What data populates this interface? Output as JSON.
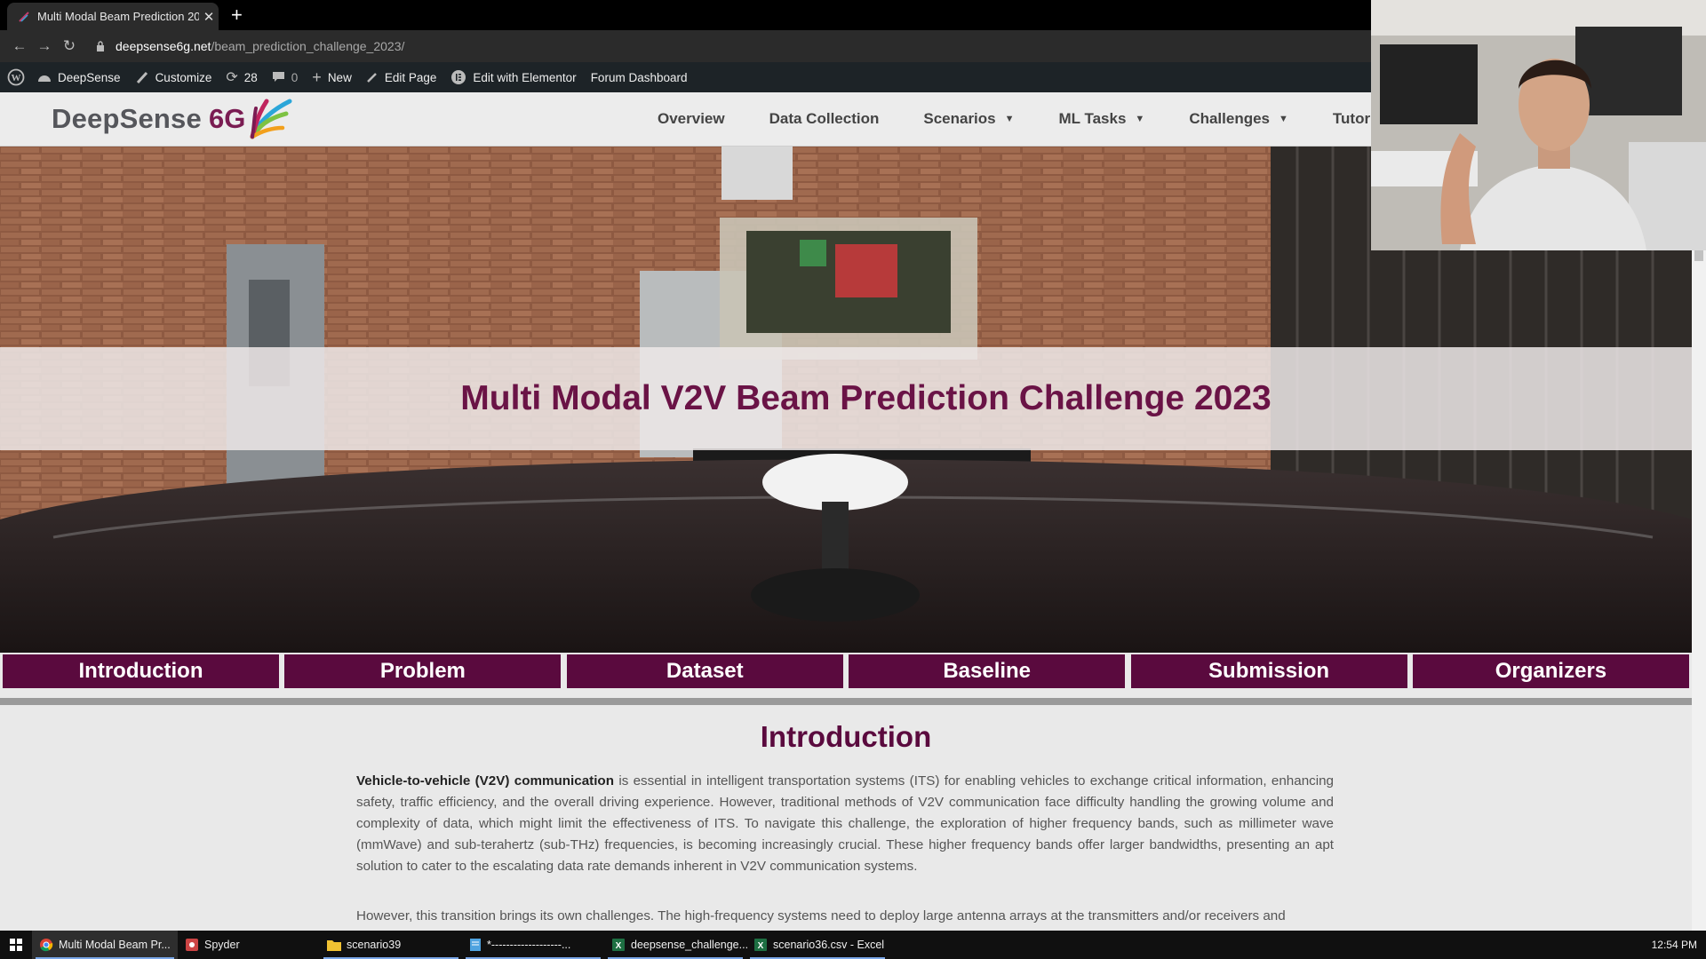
{
  "browser": {
    "tab_title": "Multi Modal Beam Prediction 20...",
    "new_tab_label": "+",
    "url_domain": "deepsense6g.net",
    "url_path": "/beam_prediction_challenge_2023/"
  },
  "admin_bar": {
    "site_name": "DeepSense",
    "customize": "Customize",
    "updates_count": "28",
    "comments_count": "0",
    "new_label": "New",
    "edit_page": "Edit Page",
    "elementor": "Edit with Elementor",
    "forum": "Forum Dashboard"
  },
  "site": {
    "logo_text": "DeepSense",
    "logo_6g": "6G",
    "nav": [
      {
        "label": "Overview",
        "dropdown": false
      },
      {
        "label": "Data Collection",
        "dropdown": false
      },
      {
        "label": "Scenarios",
        "dropdown": true
      },
      {
        "label": "ML Tasks",
        "dropdown": true
      },
      {
        "label": "Challenges",
        "dropdown": true
      },
      {
        "label": "Tutorials",
        "dropdown": false
      }
    ]
  },
  "hero": {
    "title": "Multi Modal V2V Beam Prediction Challenge 2023"
  },
  "section_tabs": [
    "Introduction",
    "Problem",
    "Dataset",
    "Baseline",
    "Submission",
    "Organizers"
  ],
  "content": {
    "heading": "Introduction",
    "p1_bold": "Vehicle-to-vehicle (V2V) communication",
    "p1_rest": " is essential in intelligent transportation systems (ITS) for enabling vehicles to exchange critical information, enhancing safety, traffic efficiency, and the overall driving experience. However, traditional methods of V2V communication face difficulty handling the growing volume and complexity of data, which might limit the effectiveness of ITS. To navigate this challenge, the exploration of higher frequency bands, such as millimeter wave (mmWave) and sub-terahertz (sub-THz) frequencies, is becoming increasingly crucial. These higher frequency bands offer larger bandwidths, presenting an apt solution to cater to the escalating data rate demands inherent in V2V communication systems.",
    "p2": "However, this transition brings its own challenges. The high-frequency systems need to deploy large antenna arrays at the transmitters and/or receivers and"
  },
  "taskbar": {
    "items": [
      {
        "label": "Multi Modal Beam Pr...",
        "icon": "chrome-icon",
        "active": true
      },
      {
        "label": "Spyder",
        "icon": "spyder-icon",
        "active": false
      },
      {
        "label": "scenario39",
        "icon": "folder-icon",
        "active": false
      },
      {
        "label": "*-------------------...",
        "icon": "notepad-icon",
        "active": false
      },
      {
        "label": "deepsense_challenge...",
        "icon": "excel-icon",
        "active": false
      },
      {
        "label": "scenario36.csv - Excel",
        "icon": "excel-icon",
        "active": false
      }
    ],
    "clock": "12:54 PM"
  },
  "colors": {
    "brand_purple": "#5a0a3e",
    "title_purple": "#6a1346",
    "admin_bar": "#1d2327"
  }
}
